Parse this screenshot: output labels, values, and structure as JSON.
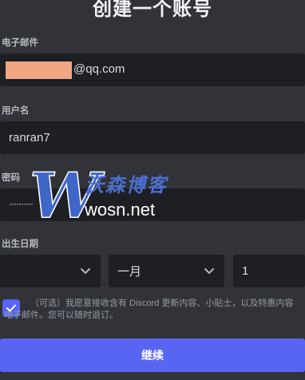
{
  "title": "创建一个账号",
  "email": {
    "label": "电子邮件",
    "value": "@qq.com"
  },
  "username": {
    "label": "用户名",
    "value": "ranran7"
  },
  "password": {
    "label": "密码",
    "value": "··········"
  },
  "dob": {
    "label": "出生日期",
    "year": "",
    "month": "一月",
    "day": "1"
  },
  "optin": {
    "checked": true,
    "text_line1": "（可选）我愿意接收含有 Discord 更新内容、小贴士，以及特惠内容",
    "text_line2": "电子邮件。您可以随时退订。"
  },
  "continue_label": "继续",
  "watermark": {
    "cn": "沃森博客",
    "en": "wosn.net",
    "letter": "W"
  },
  "colors": {
    "accent": "#5865f2",
    "background": "#313338",
    "input": "#1e1f22"
  }
}
